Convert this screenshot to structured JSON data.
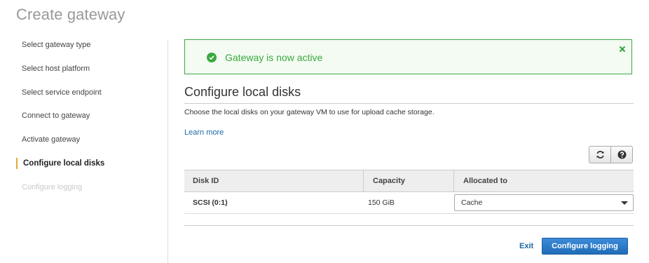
{
  "page": {
    "title": "Create gateway"
  },
  "sidebar": {
    "steps": [
      {
        "label": "Select gateway type",
        "state": "done"
      },
      {
        "label": "Select host platform",
        "state": "done"
      },
      {
        "label": "Select service endpoint",
        "state": "done"
      },
      {
        "label": "Connect to gateway",
        "state": "done"
      },
      {
        "label": "Activate gateway",
        "state": "done"
      },
      {
        "label": "Configure local disks",
        "state": "active"
      },
      {
        "label": "Configure logging",
        "state": "disabled"
      }
    ]
  },
  "alert": {
    "text": "Gateway is now active",
    "icon": "check-circle-icon",
    "color": "#39a93f"
  },
  "section": {
    "title": "Configure local disks",
    "description": "Choose the local disks on your gateway VM to use for upload cache storage.",
    "learn_more": "Learn more"
  },
  "toolbar": {
    "refresh_icon": "refresh-icon",
    "help_icon": "help-icon"
  },
  "table": {
    "columns": [
      "Disk ID",
      "Capacity",
      "Allocated to"
    ],
    "rows": [
      {
        "disk_id": "SCSI (0:1)",
        "capacity": "150 GiB",
        "allocated_to": "Cache"
      }
    ]
  },
  "footer": {
    "exit_label": "Exit",
    "primary_label": "Configure logging",
    "primary_color": "#1f6cb8"
  }
}
